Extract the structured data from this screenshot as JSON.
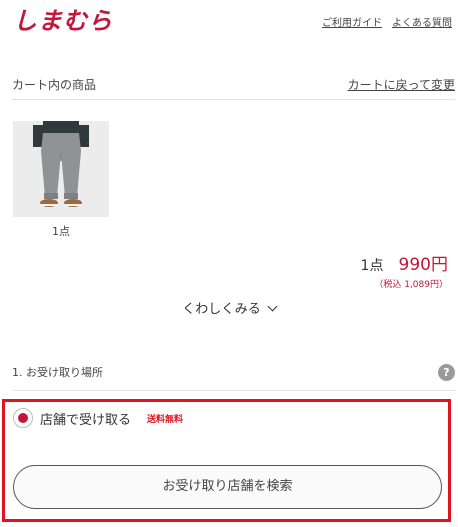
{
  "header": {
    "logo_text": "しまむら",
    "logo_color": "#c4163a",
    "links": [
      {
        "label": "ご利用ガイド"
      },
      {
        "label": "よくある質問"
      }
    ]
  },
  "cart": {
    "title": "カート内の商品",
    "back_link": "カートに戻って変更",
    "item_qty": "1点",
    "total_qty": "1点",
    "total_price": "990円",
    "tax_included": "（税込 1,089円）",
    "see_more": "くわしくみる"
  },
  "pickup": {
    "section_title": "1. お受け取り場所",
    "help_icon": "?",
    "option_label": "店舗で受け取る",
    "option_badge": "送料無料",
    "option_selected": true,
    "search_button": "お受け取り店舗を検索"
  },
  "colors": {
    "accent": "#c4163a",
    "highlight_border": "#e0141e"
  }
}
